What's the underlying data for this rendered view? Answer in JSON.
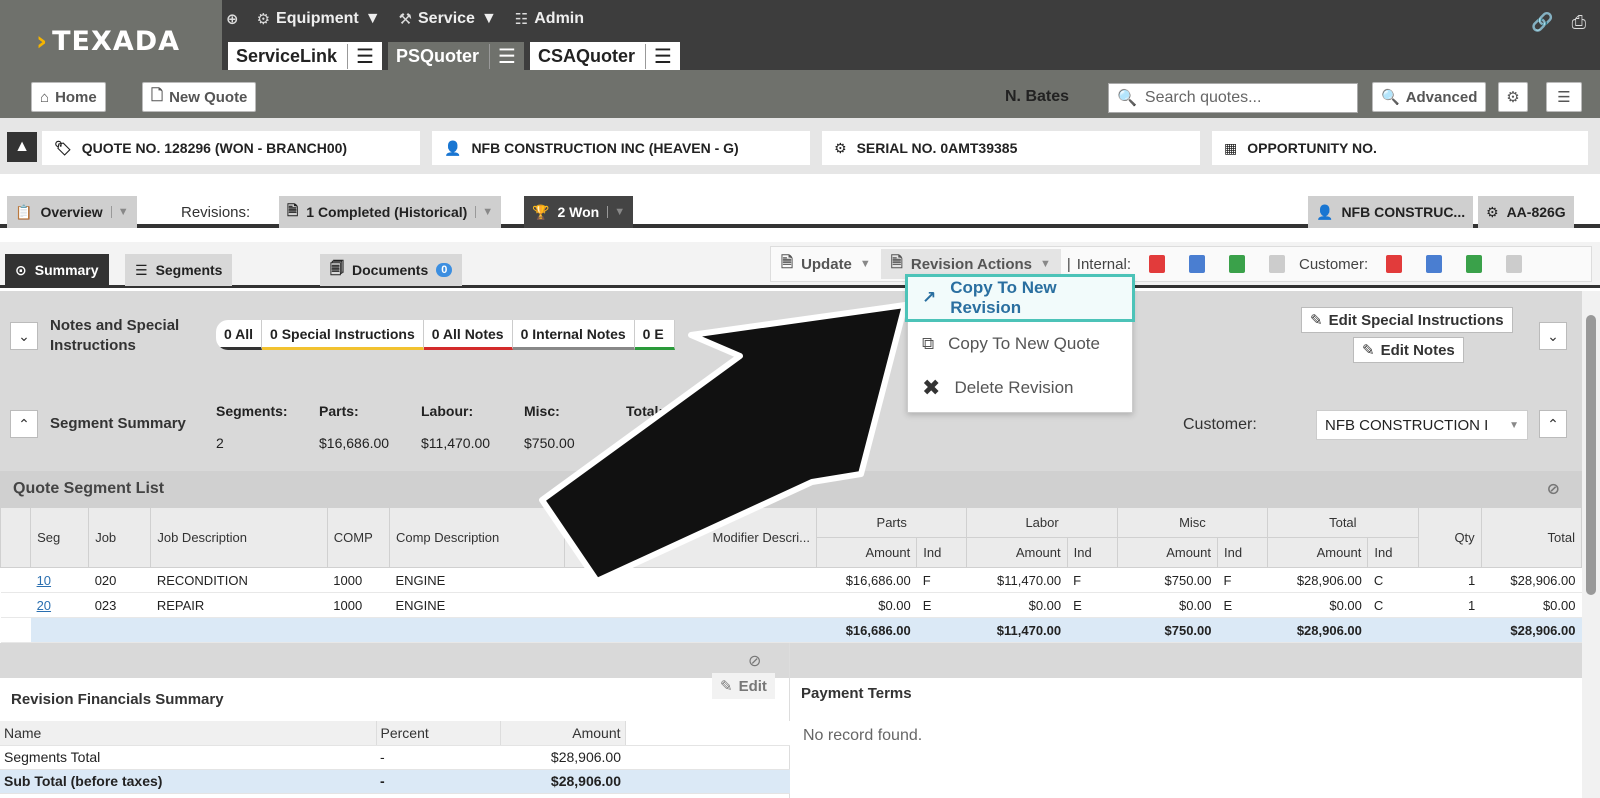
{
  "brand": {
    "logo": "TEXADA"
  },
  "topnav": {
    "equipment": "Equipment",
    "service": "Service",
    "admin": "Admin"
  },
  "apptabs": [
    {
      "label": "ServiceLink"
    },
    {
      "label": "PSQuoter"
    },
    {
      "label": "CSAQuoter"
    }
  ],
  "toolbar": {
    "home": "Home",
    "new_quote": "New Quote",
    "user": "N. Bates",
    "search_placeholder": "Search quotes...",
    "advanced": "Advanced"
  },
  "info": {
    "quote": "QUOTE NO. 128296 (WON - BRANCH00)",
    "customer": "NFB CONSTRUCTION INC (HEAVEN - G)",
    "serial": "SERIAL NO. 0AMT39385",
    "opportunity": "OPPORTUNITY NO."
  },
  "revisions": {
    "overview": "Overview",
    "label": "Revisions:",
    "completed": "1 Completed (Historical)",
    "won": "2 Won",
    "right1": "NFB CONSTRUC...",
    "right2": "AA-826G"
  },
  "subtabs": {
    "summary": "Summary",
    "segments": "Segments",
    "documents": "Documents",
    "doc_count": "0"
  },
  "actions": {
    "update": "Update",
    "revision_actions": "Revision Actions",
    "internal": "Internal:",
    "customer": "Customer:"
  },
  "menu": {
    "items": [
      "Copy To New Revision",
      "Copy To New Quote",
      "Delete Revision"
    ]
  },
  "notes": {
    "title": "Notes and Special Instructions",
    "pills": [
      "0 All",
      "0 Special Instructions",
      "0 All Notes",
      "0 Internal Notes",
      "0 E"
    ],
    "edit_special": "Edit Special Instructions",
    "edit_notes": "Edit Notes"
  },
  "segment_summary": {
    "title": "Segment Summary",
    "segments_label": "Segments:",
    "segments": "2",
    "parts_label": "Parts:",
    "parts": "$16,686.00",
    "labour_label": "Labour:",
    "labour": "$11,470.00",
    "misc_label": "Misc:",
    "misc": "$750.00",
    "total_label": "Total:",
    "customer_label": "Customer:",
    "customer": "NFB CONSTRUCTION I"
  },
  "qsl": {
    "title": "Quote Segment List",
    "groups": {
      "parts": "Parts",
      "labor": "Labor",
      "misc": "Misc",
      "total": "Total"
    },
    "cols": {
      "seg": "Seg",
      "job": "Job",
      "jobdesc": "Job Description",
      "comp": "COMP",
      "compdesc": "Comp Description",
      "moddesc": "Modifier Descri...",
      "amount": "Amount",
      "ind": "Ind",
      "qty": "Qty",
      "total": "Total"
    },
    "rows": [
      {
        "seg": "10",
        "job": "020",
        "jobdesc": "RECONDITION",
        "comp": "1000",
        "compdesc": "ENGINE",
        "p_amt": "$16,686.00",
        "p_ind": "F",
        "l_amt": "$11,470.00",
        "l_ind": "F",
        "m_amt": "$750.00",
        "m_ind": "F",
        "t_amt": "$28,906.00",
        "t_ind": "C",
        "qty": "1",
        "total": "$28,906.00"
      },
      {
        "seg": "20",
        "job": "023",
        "jobdesc": "REPAIR",
        "comp": "1000",
        "compdesc": "ENGINE",
        "p_amt": "$0.00",
        "p_ind": "E",
        "l_amt": "$0.00",
        "l_ind": "E",
        "m_amt": "$0.00",
        "m_ind": "E",
        "t_amt": "$0.00",
        "t_ind": "C",
        "qty": "1",
        "total": "$0.00"
      }
    ],
    "totals": {
      "parts": "$16,686.00",
      "labor": "$11,470.00",
      "misc": "$750.00",
      "total": "$28,906.00",
      "grand": "$28,906.00"
    }
  },
  "financials": {
    "title": "Revision Financials Summary",
    "edit": "Edit",
    "cols": [
      "Name",
      "Percent",
      "Amount"
    ],
    "rows": [
      {
        "name": "Segments Total",
        "percent": "-",
        "amount": "$28,906.00"
      },
      {
        "name": "Sub Total (before taxes)",
        "percent": "-",
        "amount": "$28,906.00"
      }
    ]
  },
  "payment": {
    "title": "Payment Terms",
    "empty": "No record found."
  }
}
